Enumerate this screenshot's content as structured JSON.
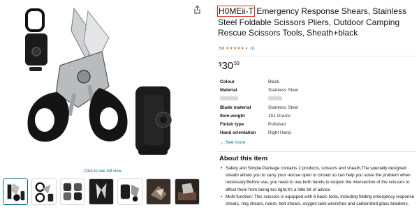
{
  "product": {
    "brand": "H0MEii-T",
    "title_rest": " Emergency Response Shears, Stainless Steel Foldable Scissors Pliers, Outdoor Camping Rescue Scissors Tools, Sheath+black"
  },
  "rating": {
    "value": "5.0",
    "stars": 5,
    "count": "(1)"
  },
  "price": {
    "symbol": "$",
    "whole": "30",
    "fraction": "59"
  },
  "specs": [
    {
      "key": "Colour",
      "value": "Black"
    },
    {
      "key": "Material",
      "value": "Stainless Steel"
    },
    {
      "key": "",
      "value": ""
    },
    {
      "key": "Blade material",
      "value": "Stainless Steel"
    },
    {
      "key": "Item weight",
      "value": "151 Grams"
    },
    {
      "key": "Finish type",
      "value": "Polished"
    },
    {
      "key": "Hand orientation",
      "value": "Right Hand"
    }
  ],
  "see_more": "See more",
  "about": {
    "title": "About this item",
    "bullets": [
      "Safety and Simple:Package contains 2 products, scissors and sheath,The specially designed sheath allows you to carry your rescue open or closed so can help you solve the problem when necessary.Before use, you need to use both hands to reopen the intersection of the scissors to affect them from being too tight,It's a little bit of advice",
      "Multi-function: This scissors is equipped with 6 basic tools, including folding emergency response shears, ring shears, rulers, belt shears, oxygen tank wrenches and carbonized glass breakers."
    ]
  },
  "gallery": {
    "zoom_hint": "Click to see full view",
    "thumbnail_count": 7
  },
  "colors": {
    "link": "#007185",
    "star": "#de7921",
    "brand_highlight": "#d93025"
  },
  "icons": {
    "share": "share-icon",
    "star": "star-icon",
    "chevron": "chevron-down-icon"
  }
}
